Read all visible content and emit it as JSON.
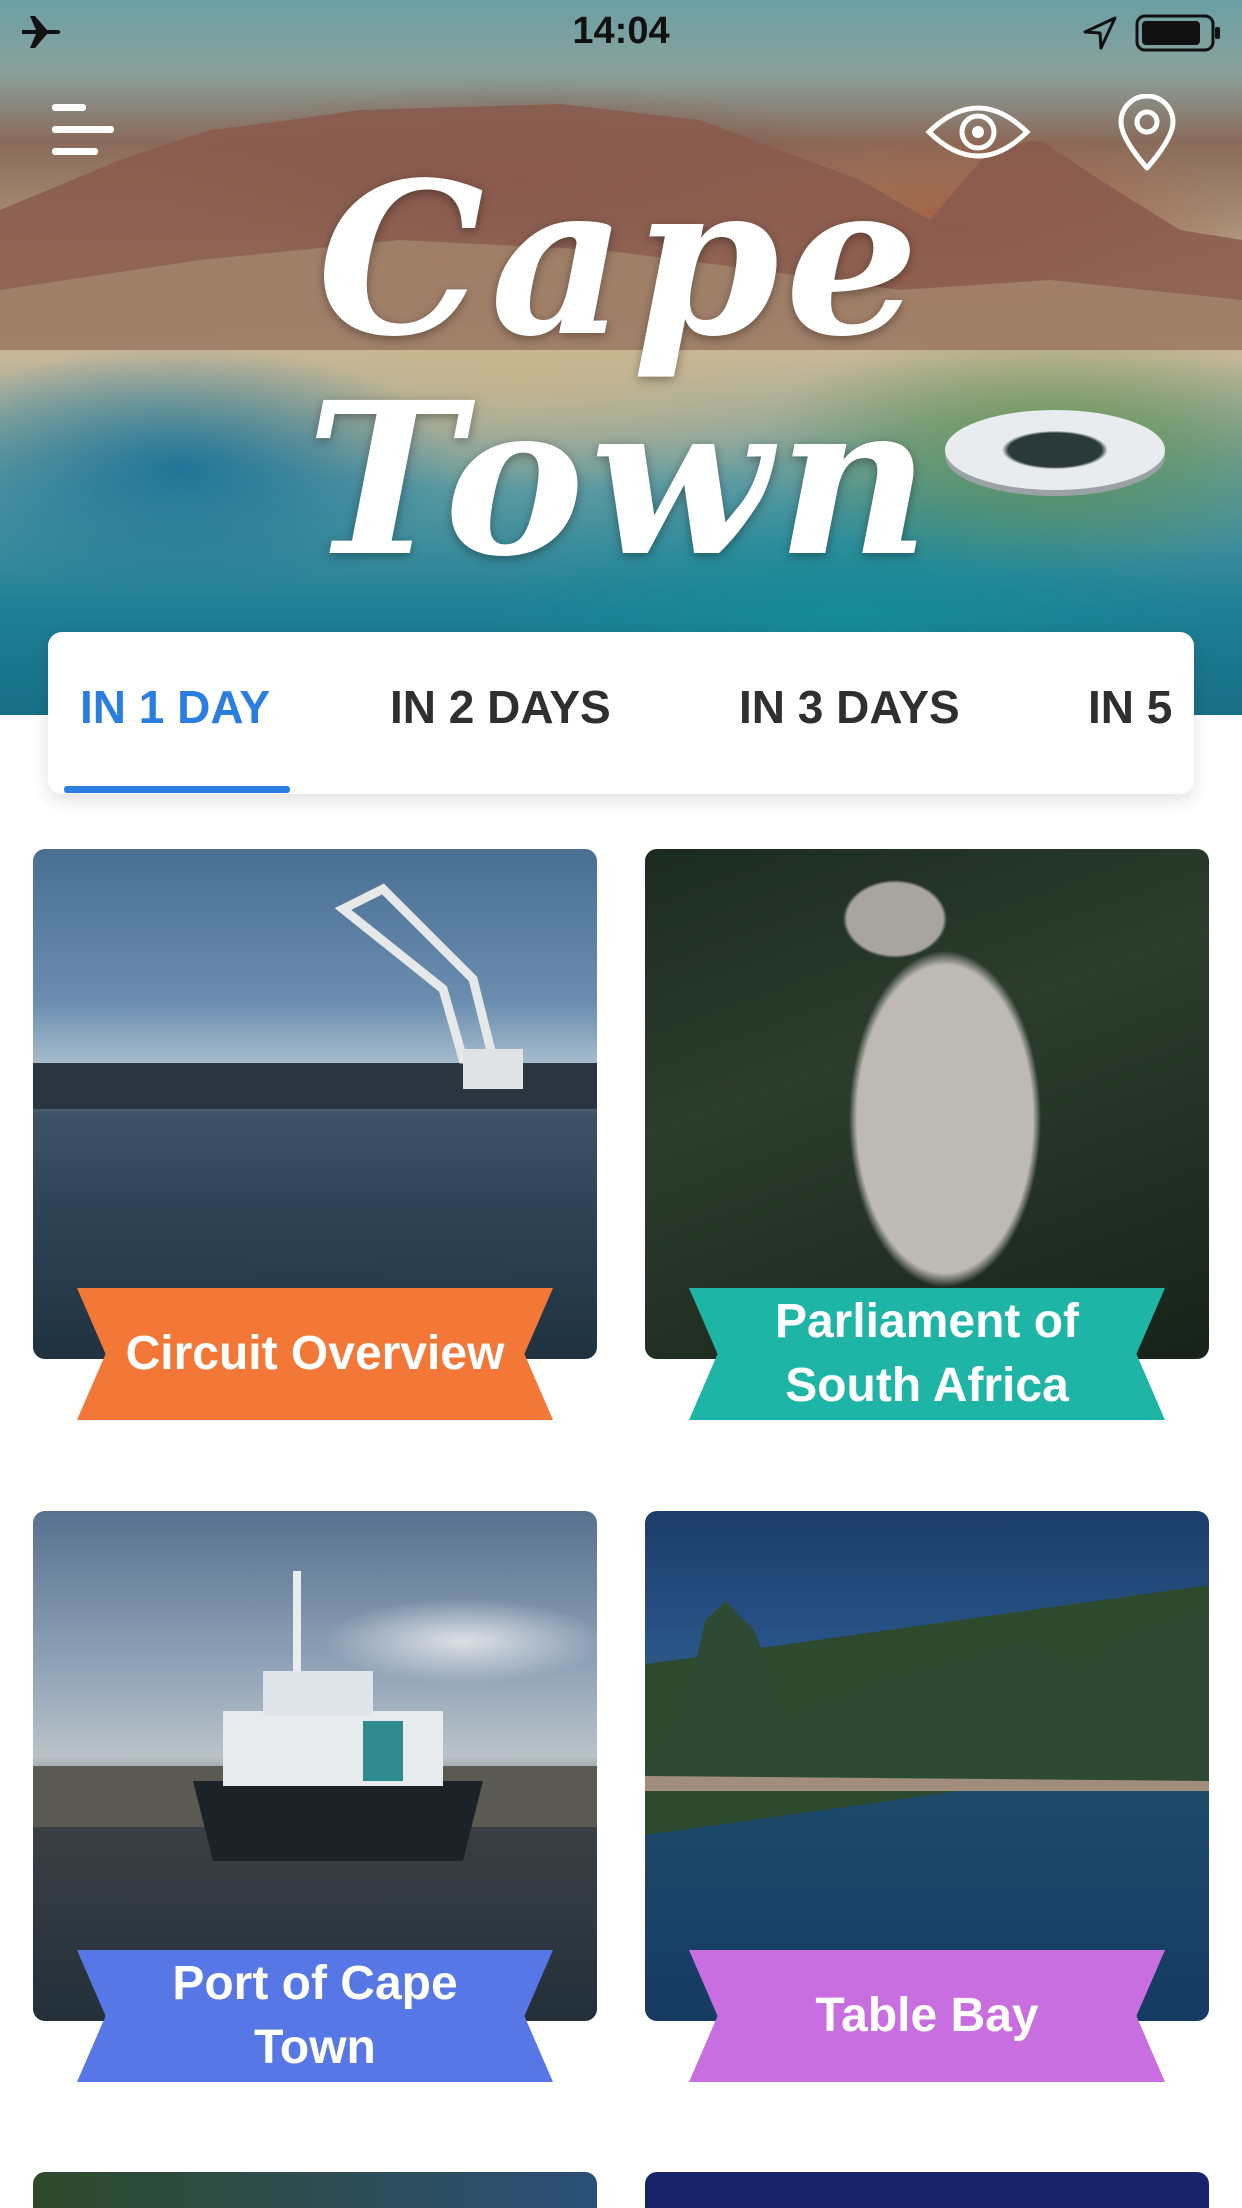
{
  "status_bar": {
    "time": "14:04"
  },
  "hero": {
    "title": "Cape Town"
  },
  "tabs": [
    {
      "label": "IN 1 DAY",
      "active": true
    },
    {
      "label": "IN 2 DAYS",
      "active": false
    },
    {
      "label": "IN 3 DAYS",
      "active": false
    },
    {
      "label": "IN 5",
      "active": false
    }
  ],
  "colors": {
    "accent": "#2a7de1",
    "ribbon_orange": "#f37838",
    "ribbon_teal": "#1fb5a6",
    "ribbon_blue": "#5877e6",
    "ribbon_purple": "#c86ee0"
  },
  "icons": [
    "airplane-icon",
    "location-arrow-icon",
    "battery-icon",
    "menu-icon",
    "eye-icon",
    "map-pin-icon"
  ],
  "cards": [
    {
      "title": "Circuit Overview"
    },
    {
      "title": "Parliament of South Africa"
    },
    {
      "title": "Port of Cape Town"
    },
    {
      "title": "Table Bay"
    }
  ]
}
